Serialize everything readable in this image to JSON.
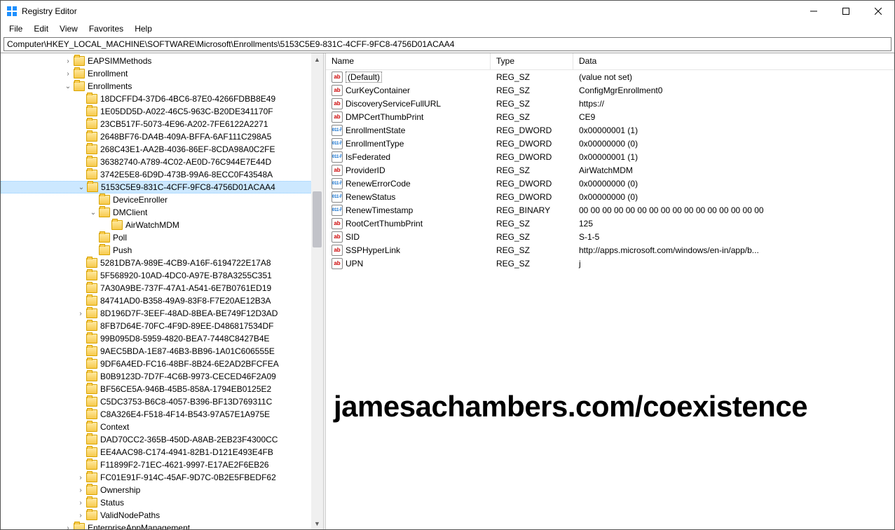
{
  "window": {
    "title": "Registry Editor"
  },
  "menu": {
    "file": "File",
    "edit": "Edit",
    "view": "View",
    "favorites": "Favorites",
    "help": "Help"
  },
  "address": "Computer\\HKEY_LOCAL_MACHINE\\SOFTWARE\\Microsoft\\Enrollments\\5153C5E9-831C-4CFF-9FC8-4756D01ACAA4",
  "columns": {
    "name": "Name",
    "type": "Type",
    "data": "Data"
  },
  "tree": {
    "top": [
      {
        "label": "EAPSIMMethods",
        "indent": 5,
        "twisty": "collapsed"
      },
      {
        "label": "Enrollment",
        "indent": 5,
        "twisty": "collapsed"
      },
      {
        "label": "Enrollments",
        "indent": 5,
        "twisty": "expanded"
      }
    ],
    "guids_before": [
      "18DCFFD4-37D6-4BC6-87E0-4266FDBB8E49",
      "1E05DD5D-A022-46C5-963C-B20DE341170F",
      "23CB517F-5073-4E96-A202-7FE6122A2271",
      "2648BF76-DA4B-409A-BFFA-6AF111C298A5",
      "268C43E1-AA2B-4036-86EF-8CDA98A0C2FE",
      "36382740-A789-4C02-AE0D-76C944E7E44D",
      "3742E5E8-6D9D-473B-99A6-8ECC0F43548A"
    ],
    "selected": "5153C5E9-831C-4CFF-9FC8-4756D01ACAA4",
    "children": [
      {
        "label": "DeviceEnroller",
        "indent": 7,
        "twisty": ""
      },
      {
        "label": "DMClient",
        "indent": 7,
        "twisty": "expanded"
      },
      {
        "label": "AirWatchMDM",
        "indent": 8,
        "twisty": ""
      },
      {
        "label": "Poll",
        "indent": 7,
        "twisty": ""
      },
      {
        "label": "Push",
        "indent": 7,
        "twisty": ""
      }
    ],
    "guids_after": [
      "5281DB7A-989E-4CB9-A16F-6194722E17A8",
      "5F568920-10AD-4DC0-A97E-B78A3255C351",
      "7A30A9BE-737F-47A1-A541-6E7B0761ED19",
      "84741AD0-B358-49A9-83F8-F7E20AE12B3A",
      "8D196D7F-3EEF-48AD-8BEA-BE749F12D3AD",
      "8FB7D64E-70FC-4F9D-89EE-D486817534DF",
      "99B095D8-5959-4820-BEA7-7448C8427B4E",
      "9AEC5BDA-1E87-46B3-BB96-1A01C606555E",
      "9DF6A4ED-FC16-48BF-8B24-6E2AD2BFCFEA",
      "B0B9123D-7D7F-4C6B-9973-CECED46F2A09",
      "BF56CE5A-946B-45B5-858A-1794EB0125E2",
      "C5DC3753-B6C8-4057-B396-BF13D769311C",
      "C8A326E4-F518-4F14-B543-97A57E1A975E",
      "Context",
      "DAD70CC2-365B-450D-A8AB-2EB23F4300CC",
      "EE4AAC98-C174-4941-82B1-D121E493E4FB",
      "F11899F2-71EC-4621-9997-E17AE2F6EB26",
      "FC01E91F-914C-45AF-9D7C-0B2E5FBEDF62",
      "Ownership",
      "Status",
      "ValidNodePaths"
    ],
    "collapsed_idx": [
      4,
      17,
      18,
      19,
      20
    ],
    "after": [
      {
        "label": "EnterpriseAppManagement",
        "indent": 5,
        "twisty": "collapsed"
      }
    ]
  },
  "values": [
    {
      "name": "(Default)",
      "type": "REG_SZ",
      "data": "(value not set)",
      "icon": "str",
      "default": true
    },
    {
      "name": "CurKeyContainer",
      "type": "REG_SZ",
      "data": "ConfigMgrEnrollment0",
      "icon": "str"
    },
    {
      "name": "DiscoveryServiceFullURL",
      "type": "REG_SZ",
      "data": "https://",
      "icon": "str"
    },
    {
      "name": "DMPCertThumbPrint",
      "type": "REG_SZ",
      "data": "CE9",
      "icon": "str"
    },
    {
      "name": "EnrollmentState",
      "type": "REG_DWORD",
      "data": "0x00000001 (1)",
      "icon": "num"
    },
    {
      "name": "EnrollmentType",
      "type": "REG_DWORD",
      "data": "0x00000000 (0)",
      "icon": "num"
    },
    {
      "name": "IsFederated",
      "type": "REG_DWORD",
      "data": "0x00000001 (1)",
      "icon": "num"
    },
    {
      "name": "ProviderID",
      "type": "REG_SZ",
      "data": "AirWatchMDM",
      "icon": "str"
    },
    {
      "name": "RenewErrorCode",
      "type": "REG_DWORD",
      "data": "0x00000000 (0)",
      "icon": "num"
    },
    {
      "name": "RenewStatus",
      "type": "REG_DWORD",
      "data": "0x00000000 (0)",
      "icon": "num"
    },
    {
      "name": "RenewTimestamp",
      "type": "REG_BINARY",
      "data": "00 00 00 00 00 00 00 00 00 00 00 00 00 00 00 00",
      "icon": "num"
    },
    {
      "name": "RootCertThumbPrint",
      "type": "REG_SZ",
      "data": "125",
      "icon": "str"
    },
    {
      "name": "SID",
      "type": "REG_SZ",
      "data": "S-1-5",
      "icon": "str"
    },
    {
      "name": "SSPHyperLink",
      "type": "REG_SZ",
      "data": "http://apps.microsoft.com/windows/en-in/app/b...",
      "icon": "str"
    },
    {
      "name": "UPN",
      "type": "REG_SZ",
      "data": "j",
      "icon": "str"
    }
  ],
  "watermark": "jamesachambers.com/coexistence"
}
